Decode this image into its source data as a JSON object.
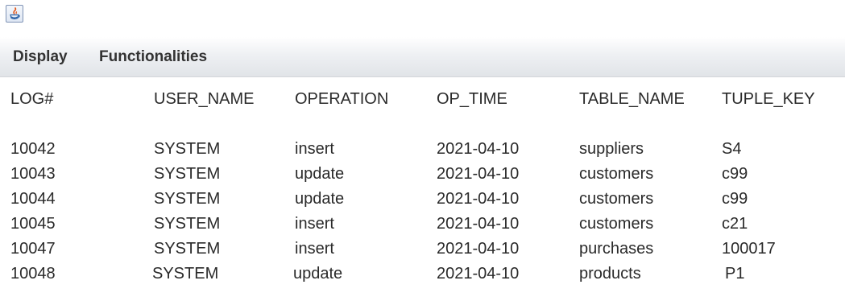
{
  "menubar": {
    "items": [
      {
        "label": "Display"
      },
      {
        "label": "Functionalities"
      }
    ]
  },
  "table": {
    "headers": [
      "LOG#",
      "USER_NAME",
      "OPERATION",
      "OP_TIME",
      "TABLE_NAME",
      "TUPLE_KEY"
    ],
    "rows": [
      [
        "10042",
        "SYSTEM",
        "insert",
        "2021-04-10",
        "suppliers",
        "S4"
      ],
      [
        "10043",
        "SYSTEM",
        "update",
        "2021-04-10",
        "customers",
        "c99"
      ],
      [
        "10044",
        "SYSTEM",
        "update",
        "2021-04-10",
        "customers",
        "c99"
      ],
      [
        "10045",
        "SYSTEM",
        "insert",
        "2021-04-10",
        "customers",
        "c21"
      ],
      [
        "10047",
        "SYSTEM",
        "insert",
        "2021-04-10",
        "purchases",
        "100017"
      ],
      [
        "10048",
        "SYSTEM",
        "update",
        "2021-04-10",
        "products",
        "P1"
      ]
    ]
  }
}
